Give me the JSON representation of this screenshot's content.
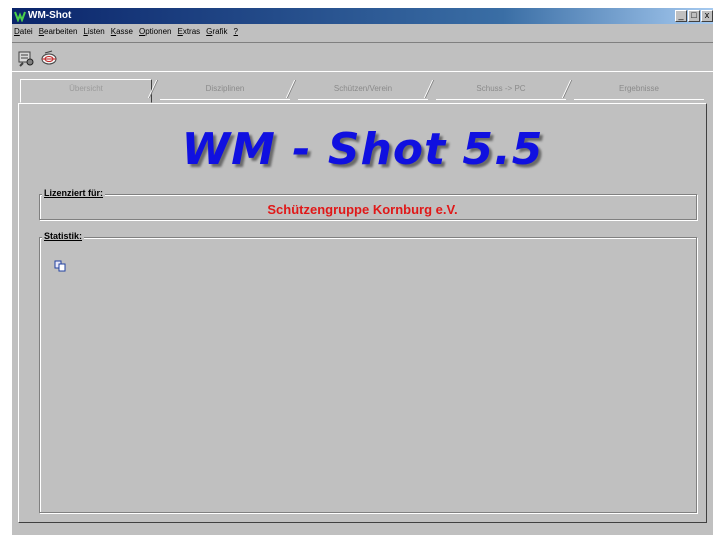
{
  "window": {
    "title": "WM-Shot",
    "buttons": {
      "minimize": "_",
      "restore": "□",
      "close": "x"
    }
  },
  "menu": [
    {
      "first": "D",
      "rest": "atei"
    },
    {
      "first": "B",
      "rest": "earbeiten"
    },
    {
      "first": "L",
      "rest": "isten"
    },
    {
      "first": "K",
      "rest": "asse"
    },
    {
      "first": "O",
      "rest": "ptionen"
    },
    {
      "first": "E",
      "rest": "xtras"
    },
    {
      "first": "G",
      "rest": "rafik"
    },
    {
      "first": "?",
      "rest": ""
    }
  ],
  "toolbar": {
    "icons": [
      "tool-settings-icon",
      "target-icon"
    ]
  },
  "tabs": [
    {
      "label": "Übersicht",
      "active": true
    },
    {
      "label": "Disziplinen",
      "active": false
    },
    {
      "label": "Schützen/Verein",
      "active": false
    },
    {
      "label": "Schuss -> PC",
      "active": false
    },
    {
      "label": "Ergebnisse",
      "active": false
    }
  ],
  "main": {
    "app_title": "WM - Shot 5.5",
    "license_label": "Lizenziert für:",
    "licensee": "Schützengruppe Kornburg e.V.",
    "stats_label": "Statistik:"
  },
  "colors": {
    "title_blue": "#1010e0",
    "licensee_red": "#e01818",
    "face": "#c0c0c0"
  }
}
